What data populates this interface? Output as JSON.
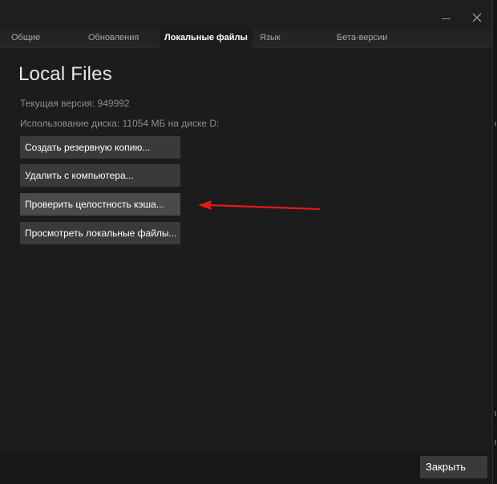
{
  "window": {
    "close_glyph": "✕"
  },
  "tabs": [
    {
      "label": "Общие"
    },
    {
      "label": "Обновления"
    },
    {
      "label": "Локальные файлы",
      "active": true
    },
    {
      "label": "Язык"
    },
    {
      "label": "Бета-версии"
    }
  ],
  "main": {
    "title": "Local Files",
    "current_version": "Текущая версия: 949992",
    "disk_usage": "Использование диска: 11054 МБ на диске D:",
    "buttons": [
      {
        "label": "Создать резервную копию..."
      },
      {
        "label": "Удалить с компьютера..."
      },
      {
        "label": "Проверить целостность кэша..."
      },
      {
        "label": "Просмотреть локальные файлы..."
      }
    ]
  },
  "footer": {
    "close_label": "Закрыть"
  },
  "annotation": {
    "arrow_color": "#e11b1b"
  },
  "colors": {
    "background": "#1c1c1c",
    "button": "#3a3a3a",
    "active_tab_text": "#ffffff",
    "tab_text": "#a8a8a8"
  }
}
